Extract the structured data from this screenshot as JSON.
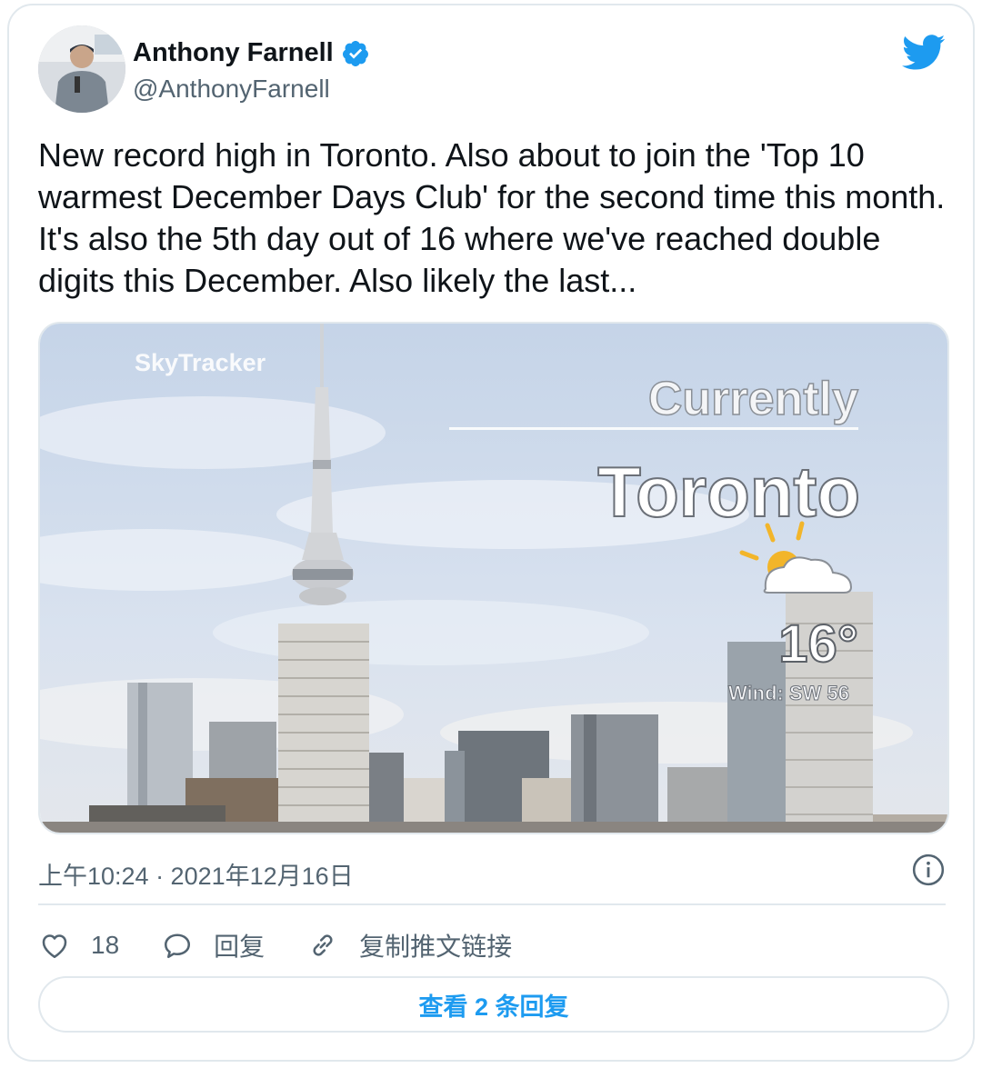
{
  "colors": {
    "accent": "#1d9bf0",
    "text_primary": "#0f1419",
    "text_secondary": "#536471",
    "border": "#e1e8ed"
  },
  "author": {
    "name": "Anthony Farnell",
    "handle": "@AnthonyFarnell",
    "verified": true,
    "avatar_icon": "avatar-photo"
  },
  "tweet": {
    "text": "New record high in Toronto. Also about to join the 'Top 10 warmest December Days Club' for the second time this month. It's also the 5th day out of 16 where we've reached double digits this December. Also likely the last...",
    "timestamp": "上午10:24 · 2021年12月16日"
  },
  "media": {
    "brand": "SkyTracker",
    "heading": "Currently",
    "city": "Toronto",
    "weather_icon": "partly-sunny-icon",
    "temperature": "16°",
    "wind": "Wind: SW 56"
  },
  "actions": {
    "like_count": "18",
    "reply_label": "回复",
    "copy_link_label": "复制推文链接"
  },
  "replies_button": "查看 2 条回复"
}
